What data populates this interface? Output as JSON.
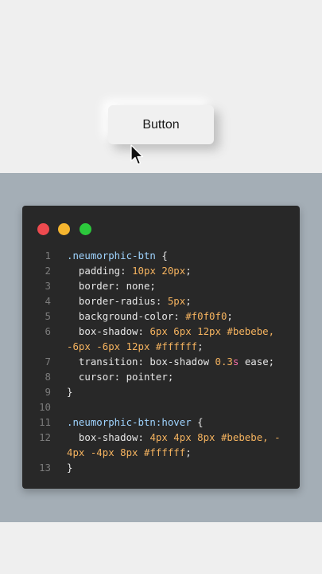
{
  "demo": {
    "button_label": "Button"
  },
  "code": {
    "lines": [
      {
        "n": "1",
        "parts": [
          {
            "t": ".neumorphic-btn",
            "c": "sel"
          },
          {
            "t": " {",
            "c": ""
          }
        ]
      },
      {
        "n": "2",
        "parts": [
          {
            "t": "  padding: ",
            "c": ""
          },
          {
            "t": "10px 20px",
            "c": "num"
          },
          {
            "t": ";",
            "c": ""
          }
        ]
      },
      {
        "n": "3",
        "parts": [
          {
            "t": "  border: none;",
            "c": ""
          }
        ]
      },
      {
        "n": "4",
        "parts": [
          {
            "t": "  border-radius: ",
            "c": ""
          },
          {
            "t": "5px",
            "c": "num"
          },
          {
            "t": ";",
            "c": ""
          }
        ]
      },
      {
        "n": "5",
        "parts": [
          {
            "t": "  background-color: ",
            "c": ""
          },
          {
            "t": "#f0f0f0",
            "c": "num"
          },
          {
            "t": ";",
            "c": ""
          }
        ]
      },
      {
        "n": "6",
        "parts": [
          {
            "t": "  box-shadow: ",
            "c": ""
          },
          {
            "t": "6px 6px 12px #bebebe,",
            "c": "num"
          }
        ]
      },
      {
        "n": "",
        "parts": [
          {
            "t": "-6px -6px 12px #ffffff",
            "c": "num"
          },
          {
            "t": ";",
            "c": ""
          }
        ]
      },
      {
        "n": "7",
        "parts": [
          {
            "t": "  transition: box-shadow ",
            "c": ""
          },
          {
            "t": "0.3",
            "c": "num"
          },
          {
            "t": "s",
            "c": "pink"
          },
          {
            "t": " ease;",
            "c": ""
          }
        ]
      },
      {
        "n": "8",
        "parts": [
          {
            "t": "  cursor: pointer;",
            "c": ""
          }
        ]
      },
      {
        "n": "9",
        "parts": [
          {
            "t": "}",
            "c": ""
          }
        ]
      },
      {
        "n": "10",
        "parts": []
      },
      {
        "n": "11",
        "parts": [
          {
            "t": ".neumorphic-btn:hover",
            "c": "sel"
          },
          {
            "t": " {",
            "c": ""
          }
        ]
      },
      {
        "n": "12",
        "parts": [
          {
            "t": "  box-shadow: ",
            "c": ""
          },
          {
            "t": "4px 4px 8px #bebebe, -",
            "c": "num"
          }
        ]
      },
      {
        "n": "",
        "parts": [
          {
            "t": "4px -4px 8px #ffffff",
            "c": "num"
          },
          {
            "t": ";",
            "c": ""
          }
        ]
      },
      {
        "n": "13",
        "parts": [
          {
            "t": "}",
            "c": ""
          }
        ]
      }
    ]
  },
  "colors": {
    "traffic_red": "#ee4a4f",
    "traffic_yellow": "#f5b52f",
    "traffic_green": "#2cc83c",
    "selector": "#9fd4ff",
    "value": "#f5b35f",
    "unit": "#f66fa9"
  },
  "icons": {
    "cursor": "mouse-pointer-icon"
  }
}
